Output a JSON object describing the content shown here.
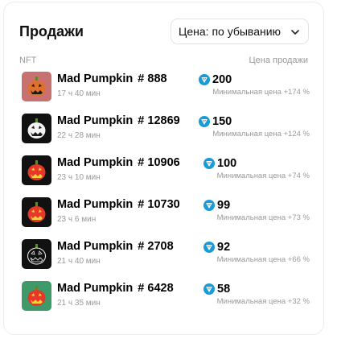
{
  "header": {
    "title": "Продажи",
    "sort_label": "Цена: по убыванию"
  },
  "columns": {
    "nft": "NFT",
    "price": "Цена продажи"
  },
  "colors": {
    "ton_blue": "#1a9bd7",
    "muted_text": "#9a9a9a"
  },
  "sales": [
    {
      "name": "Mad Pumpkin",
      "number": "# 888",
      "time": "17 ч 40 мин",
      "price": "200",
      "min_price": "Минимальная цена +174 %",
      "thumb_bg": "#c97070",
      "pumpkin": "#e0702a",
      "face": "dark"
    },
    {
      "name": "Mad Pumpkin",
      "number": "# 12869",
      "time": "22 ч 28 мин",
      "price": "150",
      "min_price": "Минимальная цена +124 %",
      "thumb_bg": "#111111",
      "pumpkin": "#f2f2f2",
      "face": "dark"
    },
    {
      "name": "Mad Pumpkin",
      "number": "# 10906",
      "time": "23 ч 10 мин",
      "price": "100",
      "min_price": "Минимальная цена +74 %",
      "thumb_bg": "#111111",
      "pumpkin": "#e8372a",
      "face": "yellow"
    },
    {
      "name": "Mad Pumpkin",
      "number": "# 10730",
      "time": "23 ч 6 мин",
      "price": "99",
      "min_price": "Минимальная цена +73 %",
      "thumb_bg": "#111111",
      "pumpkin": "#e8372a",
      "face": "yellow"
    },
    {
      "name": "Mad Pumpkin",
      "number": "# 2708",
      "time": "21 ч 40 мин",
      "price": "92",
      "min_price": "Минимальная цена +66 %",
      "thumb_bg": "#111111",
      "pumpkin": "#111111",
      "face": "outline"
    },
    {
      "name": "Mad Pumpkin",
      "number": "# 6428",
      "time": "21 ч 35 мин",
      "price": "58",
      "min_price": "Минимальная цена +32 %",
      "thumb_bg": "#3f9a6a",
      "pumpkin": "#e8372a",
      "face": "yellow"
    }
  ]
}
